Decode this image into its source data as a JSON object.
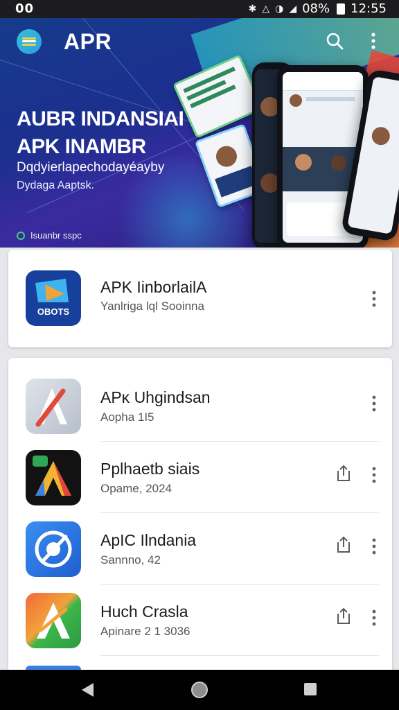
{
  "status_bar": {
    "left_text": "00",
    "battery": "08%",
    "time": "12:55",
    "icons": [
      "bluetooth-icon",
      "signal-icon",
      "wifi-icon",
      "signal-icon",
      "signal-icon",
      "battery-icon"
    ]
  },
  "app_bar": {
    "title": "APR",
    "logo_icon": "menu-logo-icon",
    "search_icon": "search-icon",
    "more_icon": "more-vert-icon"
  },
  "banner": {
    "title_line1": "AUBR INDANSIAI",
    "title_line2": "APK INAMBR",
    "subtitle": "Dqdyierlapechodayéayby",
    "subtitle2": "Dydaga Aaptsk.",
    "badge_text": "Isuanbr sspc"
  },
  "featured": {
    "name": "APK IinborlailA",
    "subtitle": "Yanlriga lql Sooinna",
    "icon_label": "OBOTS"
  },
  "apps": [
    {
      "name": "APĸ Uhgindsan",
      "subtitle": "Aopha 1I5",
      "has_share": false
    },
    {
      "name": "Pplhaetb siais",
      "subtitle": "Opame, 2024",
      "has_share": true
    },
    {
      "name": "ApIC Ilndania",
      "subtitle": "Sannno, 42",
      "has_share": true
    },
    {
      "name": "Huch Craslа",
      "subtitle": "Apinare 2 1 3036",
      "has_share": true
    }
  ],
  "colors": {
    "hero_start": "#163b8c",
    "hero_end": "#3a2aa0",
    "accent_green": "#3ad27d",
    "navbar": "#000000"
  }
}
